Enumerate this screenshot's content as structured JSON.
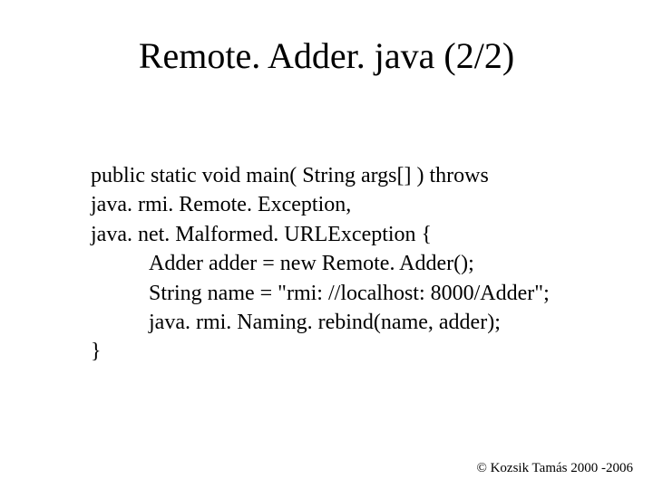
{
  "title": "Remote. Adder. java (2/2)",
  "code": {
    "l1": "public static void main( String args[] ) throws",
    "l2": "java. rmi. Remote. Exception,",
    "l3": "java. net. Malformed. URLException {",
    "l4": "Adder adder = new Remote. Adder();",
    "l5": "String name = \"rmi: //localhost: 8000/Adder\";",
    "l6": "java. rmi. Naming. rebind(name, adder);",
    "l7": "}"
  },
  "footer": "© Kozsik Tamás 2000 -2006"
}
